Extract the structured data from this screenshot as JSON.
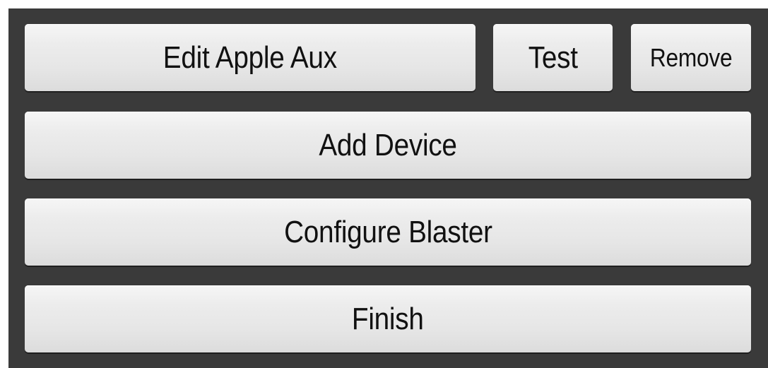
{
  "buttons": {
    "edit_label": "Edit Apple Aux",
    "test_label": "Test",
    "remove_label": "Remove",
    "add_device_label": "Add Device",
    "configure_blaster_label": "Configure Blaster",
    "finish_label": "Finish"
  },
  "colors": {
    "panel_background": "#3a3a3a",
    "button_background": "#e8e8e8",
    "button_text": "#111111"
  }
}
